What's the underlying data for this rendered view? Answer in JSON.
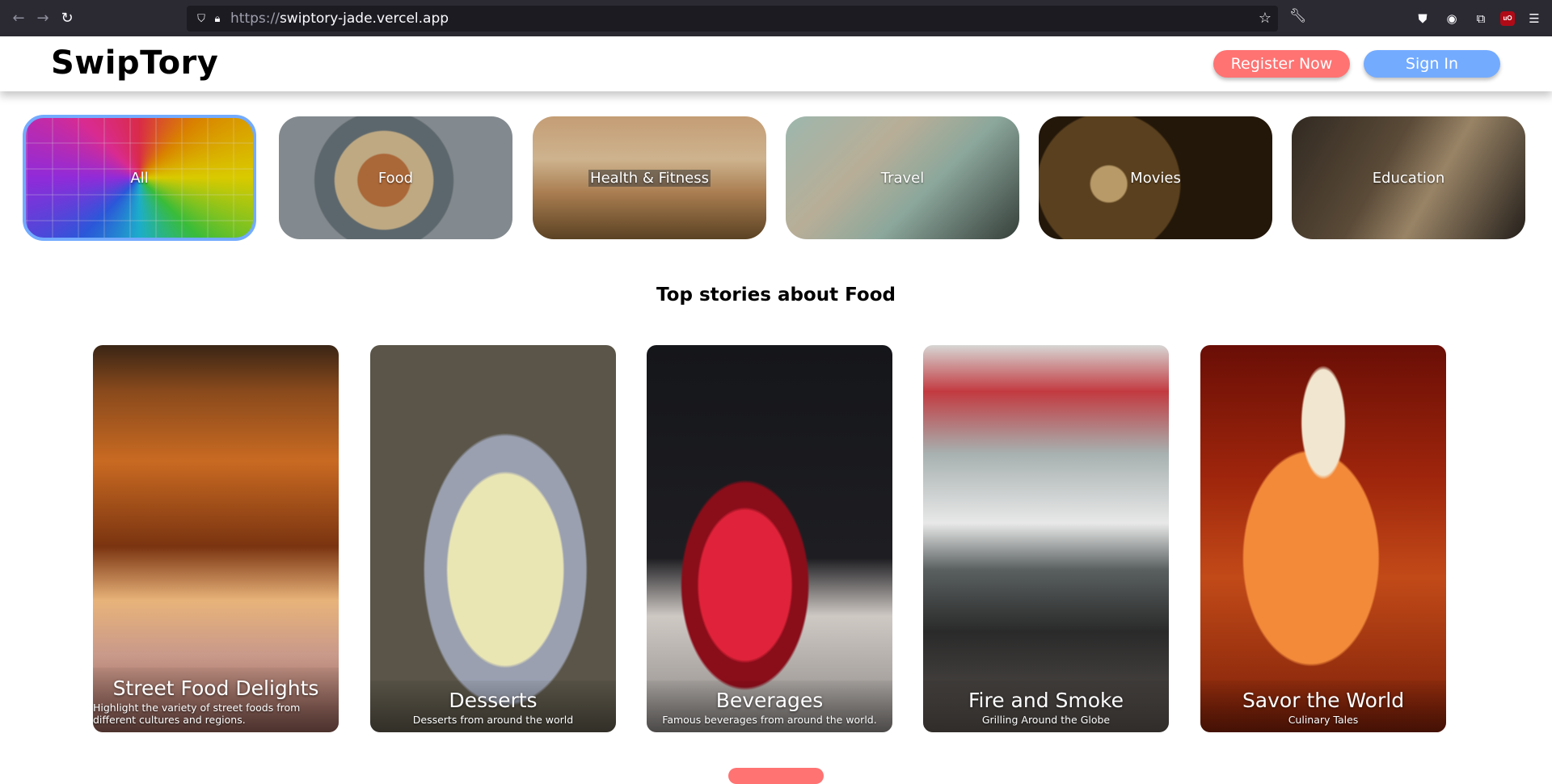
{
  "browser": {
    "url_proto": "https://",
    "url_host": "swiptory-jade.vercel.app"
  },
  "header": {
    "logo": "SwipTory",
    "register_label": "Register Now",
    "signin_label": "Sign In"
  },
  "categories": [
    {
      "label": "All",
      "selected": true
    },
    {
      "label": "Food",
      "selected": false
    },
    {
      "label": "Health & Fitness",
      "selected": false
    },
    {
      "label": "Travel",
      "selected": false
    },
    {
      "label": "Movies",
      "selected": false
    },
    {
      "label": "Education",
      "selected": false
    }
  ],
  "section": {
    "title": "Top stories about Food"
  },
  "stories": [
    {
      "title": "Street Food Delights",
      "desc": "Highlight the variety of street foods from different cultures and regions."
    },
    {
      "title": "Desserts",
      "desc": "Desserts from around the world"
    },
    {
      "title": "Beverages",
      "desc": "Famous beverages from around the world."
    },
    {
      "title": "Fire and Smoke",
      "desc": "Grilling Around the Globe"
    },
    {
      "title": "Savor the World",
      "desc": "Culinary Tales"
    }
  ],
  "colors": {
    "register": "#ff7373",
    "signin": "#73abff",
    "selected_border": "#73abff"
  }
}
